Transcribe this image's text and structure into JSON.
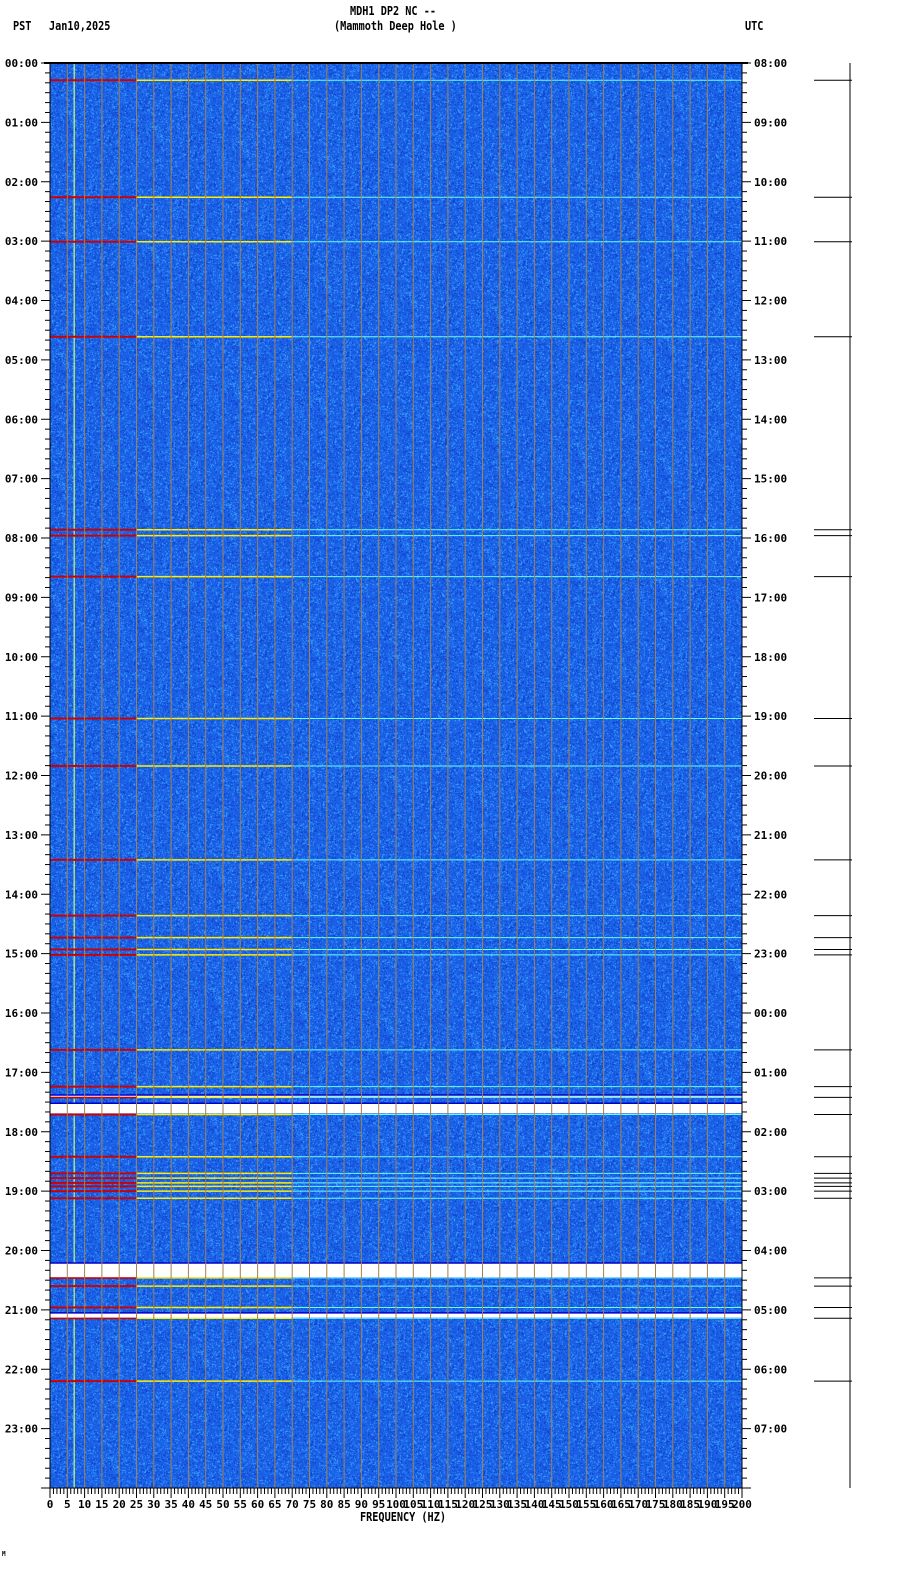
{
  "header": {
    "title": "MDH1 DP2 NC --",
    "subtitle": "(Mammoth Deep Hole )",
    "left_tz": "PST",
    "date": "Jan10,2025",
    "right_tz": "UTC"
  },
  "footer_mark": "M",
  "colors": {
    "background": "#1a5fe6",
    "grid": "#a08050",
    "event_low": "#cc0000",
    "event_mid": "#ffee00",
    "event_high": "#66ffff",
    "gap": "#ffffff"
  },
  "chart_data": {
    "type": "heatmap",
    "title": "MDH1 DP2 NC -- (Mammoth Deep Hole )",
    "xlabel": "FREQUENCY (HZ)",
    "ylabel_left": "PST",
    "ylabel_right": "UTC",
    "xlim": [
      0,
      200
    ],
    "ylim_hours": [
      0,
      24
    ],
    "x_ticks": [
      "0",
      "5",
      "10",
      "15",
      "20",
      "25",
      "30",
      "35",
      "40",
      "45",
      "50",
      "55",
      "60",
      "65",
      "70",
      "75",
      "80",
      "85",
      "90",
      "95",
      "100",
      "105",
      "110",
      "115",
      "120",
      "125",
      "130",
      "135",
      "140",
      "145",
      "150",
      "155",
      "160",
      "165",
      "170",
      "175",
      "180",
      "185",
      "190",
      "195",
      "200"
    ],
    "left_time_labels": [
      "00:00",
      "01:00",
      "02:00",
      "03:00",
      "04:00",
      "05:00",
      "06:00",
      "07:00",
      "08:00",
      "09:00",
      "10:00",
      "11:00",
      "12:00",
      "13:00",
      "14:00",
      "15:00",
      "16:00",
      "17:00",
      "18:00",
      "19:00",
      "20:00",
      "21:00",
      "22:00",
      "23:00"
    ],
    "right_time_labels": [
      "08:00",
      "09:00",
      "10:00",
      "11:00",
      "12:00",
      "13:00",
      "14:00",
      "15:00",
      "16:00",
      "17:00",
      "18:00",
      "19:00",
      "20:00",
      "21:00",
      "22:00",
      "23:00",
      "00:00",
      "01:00",
      "02:00",
      "03:00",
      "04:00",
      "05:00",
      "06:00",
      "07:00"
    ],
    "event_hours": [
      0.29,
      2.26,
      3.01,
      4.61,
      7.86,
      7.96,
      8.65,
      11.04,
      11.84,
      13.42,
      14.36,
      14.73,
      14.93,
      15.02,
      16.62,
      17.24,
      17.42,
      17.71,
      18.42,
      18.7,
      18.78,
      18.86,
      18.92,
      19.0,
      19.12,
      20.46,
      20.6,
      20.96,
      21.14,
      22.2
    ],
    "data_gaps_hours": [
      [
        17.38,
        17.41
      ],
      [
        17.52,
        17.69
      ],
      [
        20.21,
        20.45
      ],
      [
        21.05,
        21.13
      ]
    ],
    "persistent_line_hz": 7
  }
}
